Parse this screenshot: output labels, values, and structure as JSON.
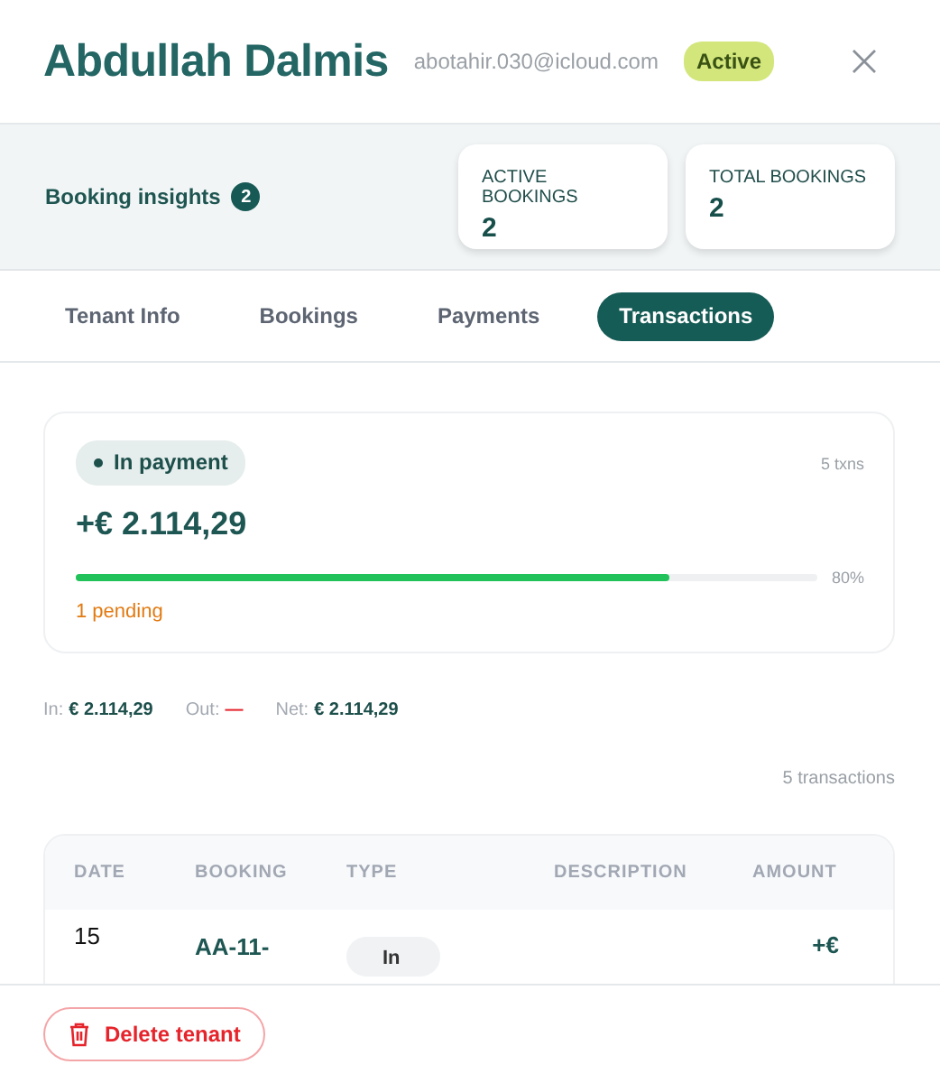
{
  "header": {
    "name": "Abdullah Dalmis",
    "email": "abotahir.030@icloud.com",
    "status": "Active"
  },
  "insights": {
    "label": "Booking insights",
    "count": "2",
    "cards": [
      {
        "label": "ACTIVE BOOKINGS",
        "value": "2"
      },
      {
        "label": "TOTAL BOOKINGS",
        "value": "2"
      }
    ]
  },
  "tabs": [
    {
      "label": "Tenant Info",
      "selected": false
    },
    {
      "label": "Bookings",
      "selected": false
    },
    {
      "label": "Payments",
      "selected": false
    },
    {
      "label": "Transactions",
      "selected": true
    }
  ],
  "summary": {
    "status": "In payment",
    "count": "5 txns",
    "amount": "+€ 2.114,29",
    "level": 0.8,
    "percent": "80%",
    "pending": "1 pending"
  },
  "totals": [
    {
      "label": "In:",
      "value": "€ 2.114,29",
      "kind": "in"
    },
    {
      "label": "Out:",
      "value": "—",
      "kind": "out"
    },
    {
      "label": "Net:",
      "value": "€ 2.114,29",
      "kind": "net"
    }
  ],
  "transactions_count": "5 transactions",
  "table": {
    "columns": [
      "DATE",
      "BOOKING",
      "TYPE",
      "DESCRIPTION",
      "AMOUNT"
    ],
    "rows": [
      {
        "date": "15",
        "booking": "AA-11-",
        "type": "In",
        "amount": "+€"
      }
    ]
  },
  "footer": {
    "delete_button": "Delete tenant"
  }
}
